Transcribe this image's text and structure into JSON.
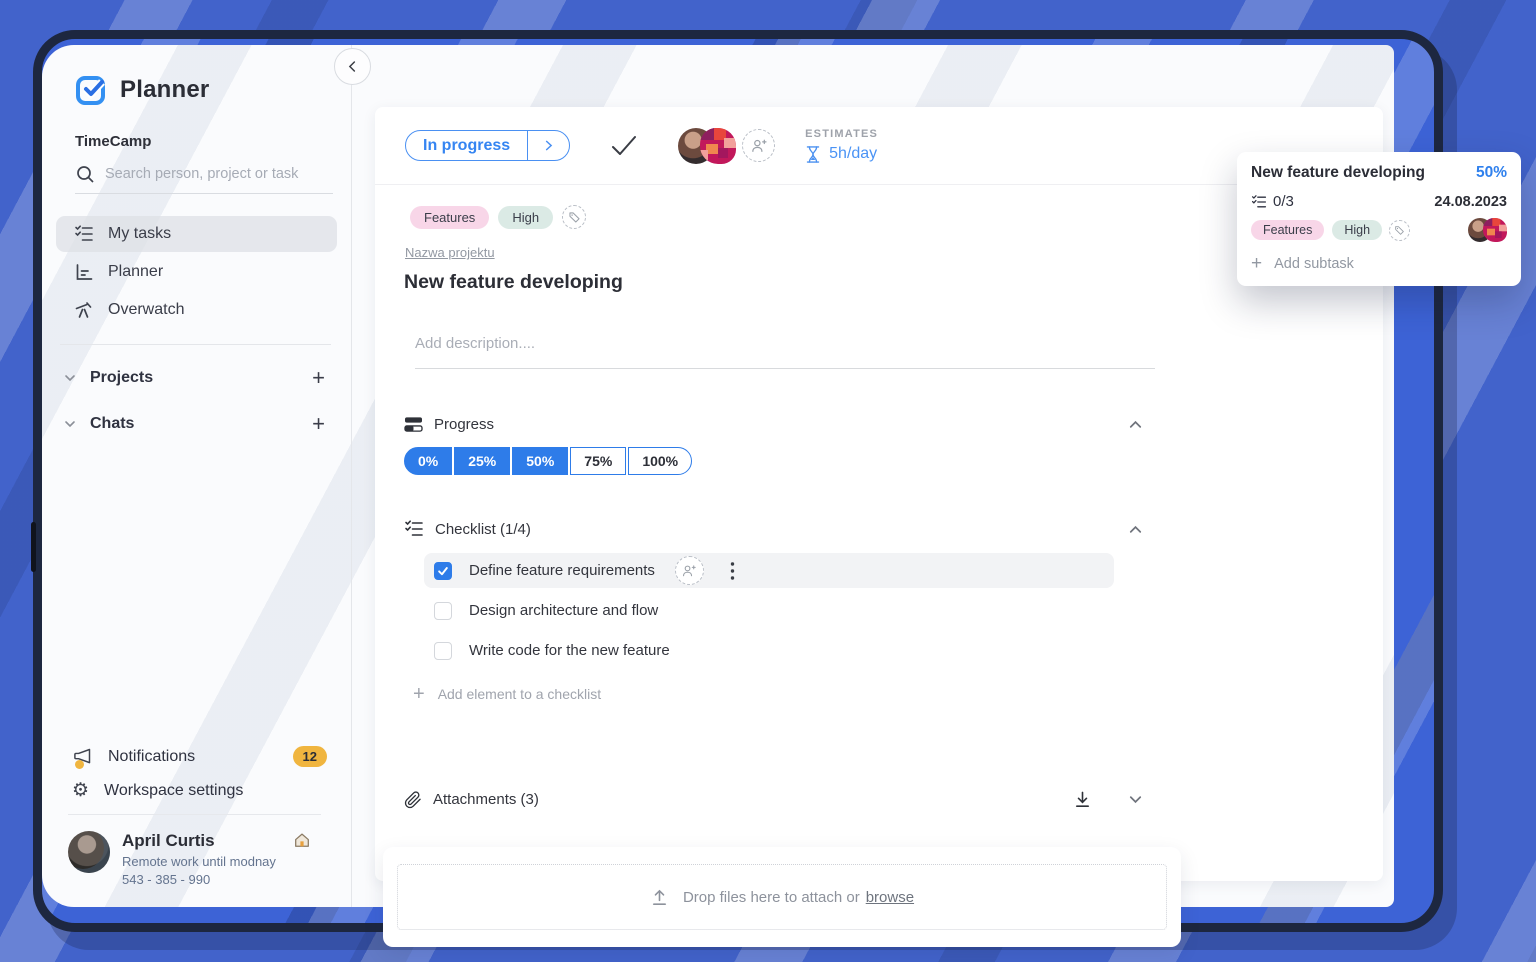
{
  "app": {
    "logo_text": "Planner",
    "workspace_name": "TimeCamp"
  },
  "sidebar": {
    "search_placeholder": "Search person, project or task",
    "menu": [
      {
        "label": "My tasks"
      },
      {
        "label": "Planner"
      },
      {
        "label": "Overwatch"
      }
    ],
    "groups": [
      {
        "label": "Projects"
      },
      {
        "label": "Chats"
      }
    ],
    "footer": {
      "notifications_label": "Notifications",
      "notifications_badge": "12",
      "settings_label": "Workspace settings"
    },
    "profile": {
      "name": "April Curtis",
      "status": "Remote work until modnay",
      "phone": "543 - 385 - 990"
    }
  },
  "task": {
    "status_label": "In progress",
    "estimates_label": "ESTIMATES",
    "estimate_value": "5h/day",
    "tags": [
      {
        "label": "Features"
      },
      {
        "label": "High"
      }
    ],
    "project_link": "Nazwa projektu",
    "title": "New feature developing",
    "description_placeholder": "Add description....",
    "progress": {
      "section_label": "Progress",
      "options": [
        "0%",
        "25%",
        "50%",
        "75%",
        "100%"
      ],
      "selected_index": 2
    },
    "checklist": {
      "section_label": "Checklist (1/4)",
      "items": [
        {
          "label": "Define feature requirements",
          "checked": true,
          "highlighted": true
        },
        {
          "label": "Design architecture and flow",
          "checked": false,
          "highlighted": false
        },
        {
          "label": "Write code for the new feature",
          "checked": false,
          "highlighted": false
        }
      ],
      "add_label": "Add element to a checklist"
    },
    "attachments": {
      "section_label": "Attachments (3)",
      "dropzone_text": "Drop files here to attach or",
      "browse_label": "browse"
    }
  },
  "tooltip": {
    "title": "New feature developing",
    "progress": "50%",
    "checklist_count": "0/3",
    "date": "24.08.2023",
    "tags": [
      {
        "label": "Features"
      },
      {
        "label": "High"
      }
    ],
    "add_subtask_label": "Add subtask"
  },
  "colors": {
    "primary_blue": "#2e7ce9",
    "light_blue_text": "#4a93f5",
    "frame_navy": "#1d2740",
    "desktop_blue": "#4263cb",
    "tag_pink": "#f8d6e8",
    "tag_teal": "#dbeae5",
    "badge_yellow": "#f0b53f"
  }
}
